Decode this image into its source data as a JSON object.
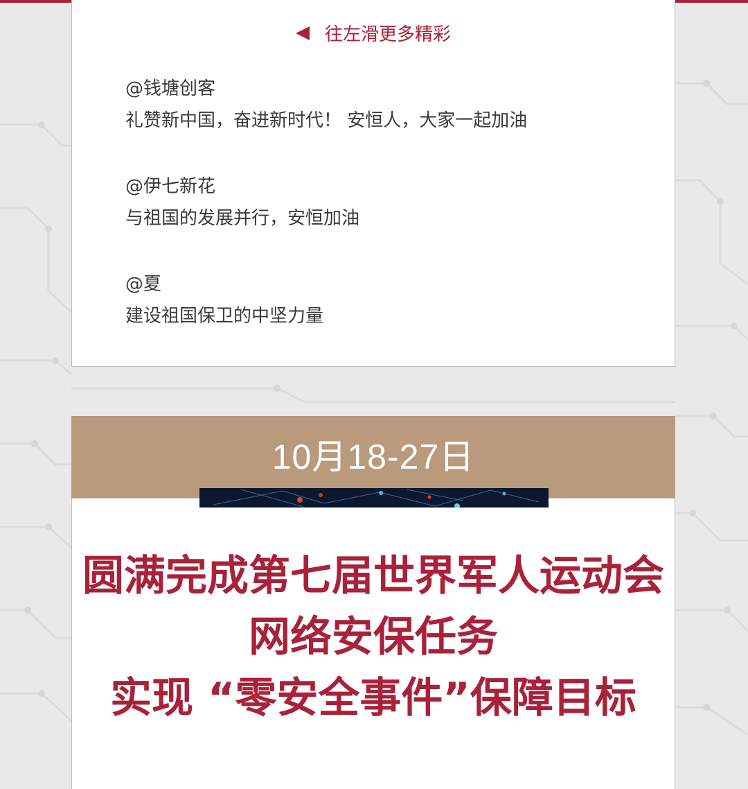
{
  "colors": {
    "accent": "#a9223a",
    "banner": "#b99a7d",
    "background": "#e9e9ea",
    "card": "#ffffff",
    "text": "#3a3a3a"
  },
  "swipe_hint": {
    "icon": "left-triangle-icon",
    "label": "往左滑更多精彩"
  },
  "comments": [
    {
      "author": "@钱塘创客",
      "text": "礼赞新中国，奋进新时代！ 安恒人，大家一起加油"
    },
    {
      "author": "@伊七新花",
      "text": "与祖国的发展并行，安恒加油"
    },
    {
      "author": "@夏",
      "text": "建设祖国保卫的中坚力量"
    }
  ],
  "event": {
    "date": "10月18-27日",
    "headline": [
      "圆满完成第七届世界军人运动会",
      "网络安保任务",
      "实现 “零安全事件”保障目标"
    ]
  }
}
